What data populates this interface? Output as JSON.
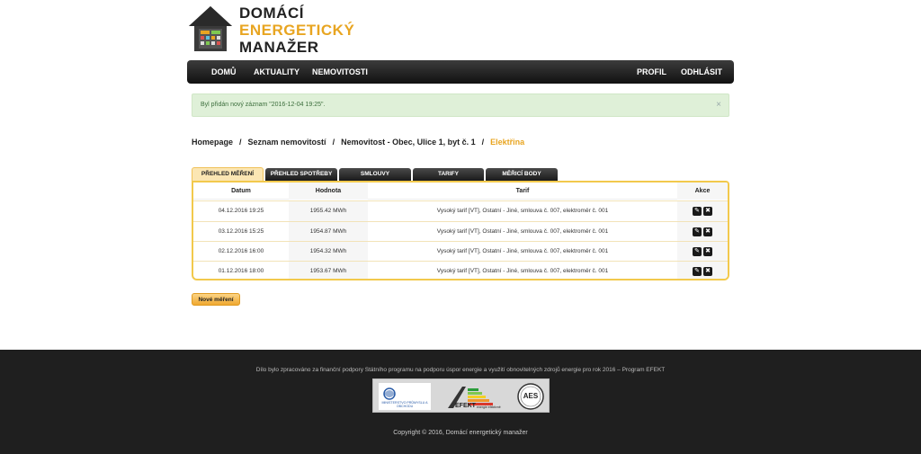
{
  "header": {
    "logo_line1": "DOMÁCÍ",
    "logo_line2": "ENERGETICKÝ",
    "logo_line3": "MANAŽER"
  },
  "nav": {
    "home": "DOMŮ",
    "news": "AKTUALITY",
    "properties": "NEMOVITOSTI",
    "profile": "PROFIL",
    "logout": "ODHLÁSIT"
  },
  "alert": {
    "message": "Byl přidán nový záznam \"2016-12-04 19:25\".",
    "close": "×"
  },
  "breadcrumb": {
    "items": [
      "Homepage",
      "Seznam nemovitostí",
      "Nemovitost - Obec, Ulice 1, byt č. 1",
      "Elektřina"
    ],
    "separator": "/"
  },
  "tabs": [
    "PŘEHLED MĚŘENÍ",
    "PŘEHLED SPOTŘEBY",
    "SMLOUVY",
    "TARIFY",
    "MĚŘICÍ BODY"
  ],
  "table": {
    "headers": [
      "Datum",
      "Hodnota",
      "Tarif",
      "Akce"
    ],
    "rows": [
      {
        "date": "04.12.2016 19:25",
        "value": "1955.42 MWh",
        "tariff": "Vysoký tarif [VT], Ostatní - Jiné, smlouva č. 007, elektroměr č. 001"
      },
      {
        "date": "03.12.2016 15:25",
        "value": "1954.87 MWh",
        "tariff": "Vysoký tarif [VT], Ostatní - Jiné, smlouva č. 007, elektroměr č. 001"
      },
      {
        "date": "02.12.2016 16:00",
        "value": "1954.32 MWh",
        "tariff": "Vysoký tarif [VT], Ostatní - Jiné, smlouva č. 007, elektroměr č. 001"
      },
      {
        "date": "01.12.2016 18:00",
        "value": "1953.67 MWh",
        "tariff": "Vysoký tarif [VT], Ostatní - Jiné, smlouva č. 007, elektroměr č. 001"
      }
    ],
    "edit_icon": "pencil-icon",
    "delete_icon": "close-icon"
  },
  "new_button": "Nové měření",
  "footer": {
    "note": "Dílo bylo zpracováno za finanční podpory Státního programu na podporu úspor energie a využití obnovitelných zdrojů energie pro rok 2016 – Program EFEKT",
    "logo1_text": "MINISTERSTVO PRŮMYSLU A OBCHODU",
    "logo2_text": "EFEKT",
    "logo2_sub": "energie efektivně",
    "logo3_text": "AES",
    "copyright": "Copyright © 2016, Domácí energetický manažer"
  },
  "colors": {
    "accent": "#e8a521",
    "navbar": "#1a1a1a",
    "alert_bg": "#dff0d8",
    "panel_border": "#f2c94c",
    "footer_bg": "#1f1f1f"
  }
}
